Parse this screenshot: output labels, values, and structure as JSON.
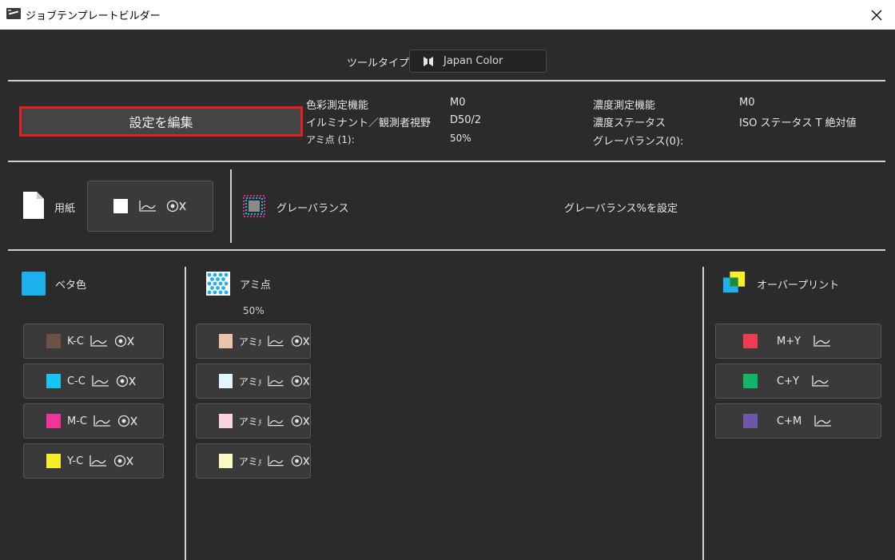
{
  "window": {
    "title": "ジョブテンプレートビルダー"
  },
  "tooltype": {
    "label": "ツールタイプ",
    "value": "Japan Color"
  },
  "settings": {
    "edit_button": "設定を編集",
    "color_measure_label": "色彩測定機能",
    "color_measure_value": "M0",
    "illuminant_label": "イルミナント／観測者視野",
    "illuminant_value": "D50/2",
    "tint_label": "アミ点 (1):",
    "tint_value": "50%",
    "density_measure_label": "濃度測定機能",
    "density_measure_value": "M0",
    "density_status_label": "濃度ステータス",
    "density_status_value": "ISO ステータス T 絶対値",
    "gray_balance_label": "グレーバランス(0):"
  },
  "paper": {
    "label": "用紙"
  },
  "gray_balance": {
    "label": "グレーバランス",
    "set_text": "グレーバランス%を設定"
  },
  "solid": {
    "label": "ベタ色",
    "items": [
      {
        "label": "K-C",
        "color": "#6b5245"
      },
      {
        "label": "C-C",
        "color": "#18c4f2"
      },
      {
        "label": "M-C",
        "color": "#f0359a"
      },
      {
        "label": "Y-C",
        "color": "#f7ef2b"
      }
    ]
  },
  "tint": {
    "label": "アミ点",
    "percent": "50%",
    "items": [
      {
        "label": "アミ点",
        "color": "#e8c4ac"
      },
      {
        "label": "アミ点",
        "color": "#dff7fd"
      },
      {
        "label": "アミ点",
        "color": "#fad4e3"
      },
      {
        "label": "アミ点",
        "color": "#fdf9c4"
      }
    ]
  },
  "overprint": {
    "label": "オーバープリント",
    "items": [
      {
        "label": "M+Y",
        "color": "#ef3b4f"
      },
      {
        "label": "C+Y",
        "color": "#10b866"
      },
      {
        "label": "C+M",
        "color": "#6f56a8"
      }
    ]
  },
  "icons": {
    "chart": "chart-line-icon",
    "disable": "target-disable-icon",
    "close": "close-icon"
  }
}
